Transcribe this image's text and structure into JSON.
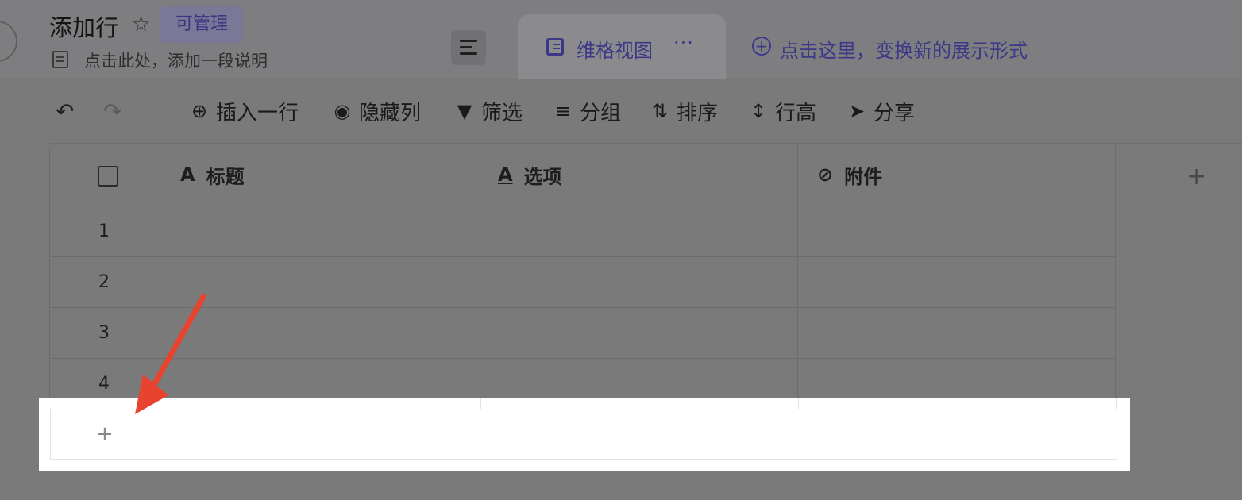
{
  "header": {
    "title": "添加行",
    "badge": "可管理",
    "description": "点击此处，添加一段说明",
    "view_tab": {
      "label": "维格视图",
      "more": "···"
    },
    "new_view": "点击这里，变换新的展示形式"
  },
  "toolbar": {
    "insert_row": "插入一行",
    "hide_columns": "隐藏列",
    "filter": "筛选",
    "group": "分组",
    "sort": "排序",
    "row_height": "行高",
    "share": "分享"
  },
  "table": {
    "columns": [
      {
        "label": "标题",
        "icon": "text-icon"
      },
      {
        "label": "选项",
        "icon": "option-icon"
      },
      {
        "label": "附件",
        "icon": "attachment-icon"
      }
    ],
    "rows": [
      "1",
      "2",
      "3",
      "4"
    ],
    "add_row": "+",
    "add_column": "+"
  },
  "colors": {
    "accent": "#3c3788",
    "arrow": "#e8432e",
    "overlay": "#7a7a7a"
  }
}
